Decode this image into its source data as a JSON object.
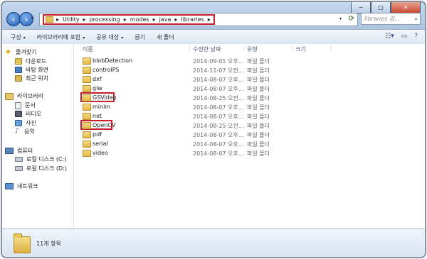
{
  "window": {
    "min": "─",
    "max": "□",
    "close": "✕"
  },
  "address": {
    "crumbs": [
      "Utility",
      "processing",
      "modes",
      "java",
      "libraries"
    ],
    "separator": "▸"
  },
  "search": {
    "placeholder": "libraries 검..."
  },
  "toolbar": {
    "organize": "구성",
    "include_library": "라이브러리에 포함",
    "share_with": "공유 대상",
    "burn": "굽기",
    "new_folder": "새 폴더"
  },
  "sidebar": {
    "favorites": {
      "label": "즐겨찾기",
      "items": [
        "다운로드",
        "바탕 화면",
        "최근 위치"
      ]
    },
    "libraries": {
      "label": "라이브러리",
      "items": [
        "문서",
        "비디오",
        "사진",
        "음악"
      ]
    },
    "computer": {
      "label": "컴퓨터",
      "items": [
        "로컬 디스크 (C:)",
        "로컬 디스크 (D:)"
      ]
    },
    "network": {
      "label": "네트워크"
    }
  },
  "columns": {
    "name": "이름",
    "date": "수정한 날짜",
    "type": "유형",
    "size": "크기"
  },
  "files": [
    {
      "name": "blobDetection",
      "date": "2014-09-01 오후...",
      "type": "파일 폴더"
    },
    {
      "name": "controlP5",
      "date": "2014-11-07 오전...",
      "type": "파일 폴더"
    },
    {
      "name": "dxf",
      "date": "2014-08-07 오후...",
      "type": "파일 폴더"
    },
    {
      "name": "glw",
      "date": "2014-08-07 오후...",
      "type": "파일 폴더"
    },
    {
      "name": "GSVideo",
      "date": "2014-08-25 오전...",
      "type": "파일 폴더",
      "highlighted": true
    },
    {
      "name": "minim",
      "date": "2014-08-07 오후...",
      "type": "파일 폴더"
    },
    {
      "name": "net",
      "date": "2014-08-07 오후...",
      "type": "파일 폴더"
    },
    {
      "name": "OpenCV",
      "date": "2014-08-25 오전...",
      "type": "파일 폴더",
      "highlighted": true
    },
    {
      "name": "pdf",
      "date": "2014-08-07 오후...",
      "type": "파일 폴더"
    },
    {
      "name": "serial",
      "date": "2014-08-07 오후...",
      "type": "파일 폴더"
    },
    {
      "name": "video",
      "date": "2014-08-07 오후...",
      "type": "파일 폴더"
    }
  ],
  "details": {
    "count": "11개 항목"
  },
  "colors": {
    "highlight_border": "#c8202a",
    "window_frame": "#a9c3e0"
  }
}
